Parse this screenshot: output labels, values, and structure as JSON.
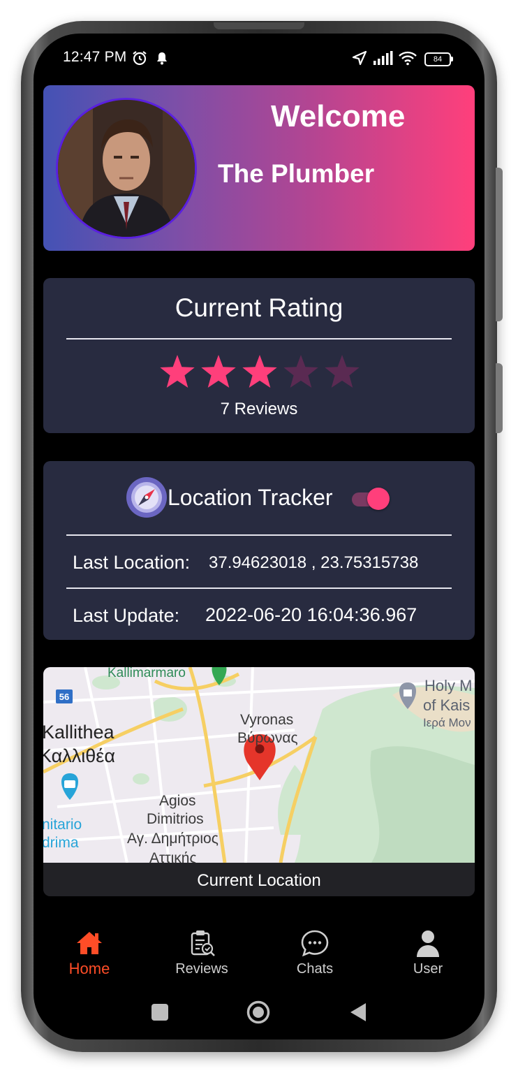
{
  "status_bar": {
    "time": "12:47 PM",
    "battery": "84",
    "icons": [
      "alarm-icon",
      "notification-bell-icon",
      "location-arrow-icon",
      "signal-icon",
      "wifi-icon",
      "battery-icon"
    ]
  },
  "profile": {
    "greeting": "Welcome",
    "name": "The Plumber",
    "avatar": "profile-photo"
  },
  "rating": {
    "title": "Current Rating",
    "stars_filled": 3,
    "stars_total": 5,
    "reviews_label": "7 Reviews"
  },
  "tracker": {
    "title": "Location Tracker",
    "enabled": true,
    "last_location_label": "Last Location:",
    "last_location_value": "37.94623018 , 23.75315738",
    "last_update_label": "Last Update:",
    "last_update_value": "2022-06-20 16:04:36.967"
  },
  "map": {
    "caption": "Current Location",
    "labels": {
      "kallimarmaro": "Kallimarmaro",
      "road_56": "56",
      "kallithea": "Kallithea",
      "kallithea_gr": "Καλλιθέα",
      "vyronas": "Vyronas",
      "vyronas_gr": "Βύρωνας",
      "holy_m": "Holy M",
      "of_kais": "of Kais",
      "iera_mon": "Ιερά Μον",
      "agios": "Agios",
      "dimitrios": "Dimitrios",
      "ag_dimitrios_gr": "Αγ. Δημήτριος",
      "attikis": "Αττικής",
      "nitario": "nitario",
      "drima": "drima"
    }
  },
  "bottom_nav": {
    "items": [
      {
        "label": "Home",
        "icon": "home-icon",
        "active": true
      },
      {
        "label": "Reviews",
        "icon": "reviews-clipboard-icon",
        "active": false
      },
      {
        "label": "Chats",
        "icon": "chat-bubble-icon",
        "active": false
      },
      {
        "label": "User",
        "icon": "user-icon",
        "active": false
      }
    ]
  },
  "colors": {
    "card_bg": "#282b40",
    "accent_pink": "#ff3f7b",
    "nav_active": "#ff4d27",
    "gradient_start": "#4452b5",
    "gradient_end": "#ff3f7b"
  }
}
